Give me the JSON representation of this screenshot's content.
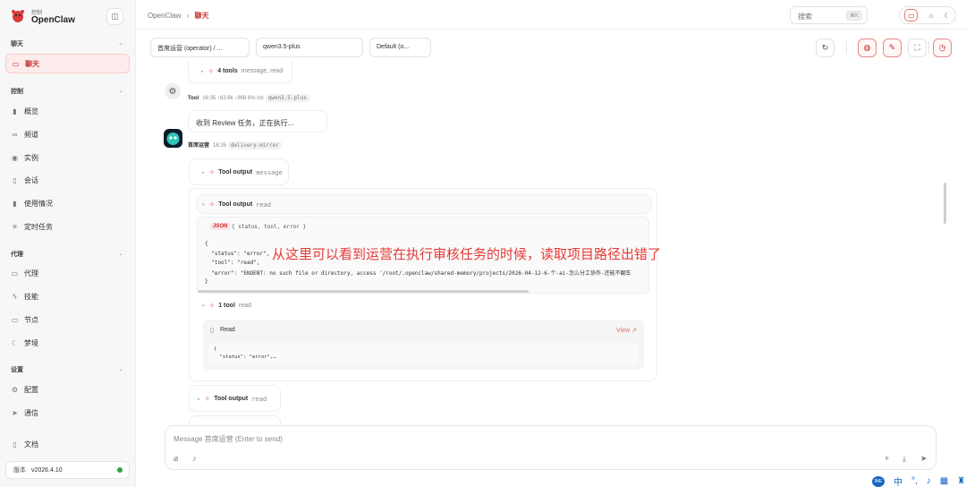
{
  "app": {
    "brand_sub": "控制",
    "brand": "OpenClaw"
  },
  "sidebar": {
    "sections": [
      {
        "title": "聊天"
      },
      {
        "title": "控制"
      },
      {
        "title": "代理"
      },
      {
        "title": "设置"
      }
    ],
    "items": [
      {
        "label": "聊天",
        "icon": "chat-icon"
      },
      {
        "label": "概览",
        "icon": "bar-chart-icon"
      },
      {
        "label": "频道",
        "icon": "link-icon"
      },
      {
        "label": "实例",
        "icon": "radio-icon"
      },
      {
        "label": "会话",
        "icon": "file-icon"
      },
      {
        "label": "使用情况",
        "icon": "bar-chart-icon"
      },
      {
        "label": "定时任务",
        "icon": "spinner-icon"
      },
      {
        "label": "代理",
        "icon": "folder-icon"
      },
      {
        "label": "技能",
        "icon": "bolt-icon"
      },
      {
        "label": "节点",
        "icon": "monitor-icon"
      },
      {
        "label": "梦境",
        "icon": "moon-icon"
      },
      {
        "label": "配置",
        "icon": "gear-icon"
      },
      {
        "label": "通信",
        "icon": "send-icon"
      },
      {
        "label": "文档",
        "icon": "book-icon"
      }
    ],
    "version_label": "版本",
    "version": "v2026.4.10"
  },
  "header": {
    "crumb_root": "OpenClaw",
    "crumb_sep": "›",
    "crumb_current": "聊天",
    "search_placeholder": "搜索",
    "search_kbd": "⌘K"
  },
  "toolbar": {
    "session": "首席运营 (operator) / ...",
    "model": "qwen3.5-plus",
    "thinking": "Default (o..."
  },
  "messages": {
    "tools4_title": "4 tools",
    "tools4_sub": "message, read",
    "tool_meta_name": "Tool",
    "tool_meta_time": "16:35",
    "tool_meta_stats": "↑63.6k ↓969 6% ctx",
    "tool_meta_model": "qwen3.5-plus",
    "bubble": "收到 Review 任务，正在执行...",
    "agent_meta_name": "首席运营",
    "agent_meta_time": "16:35",
    "agent_meta_tag": "delivery-mirror",
    "out1_title": "Tool output",
    "out1_sub": "message",
    "out2_title": "Tool output",
    "out2_sub": "read",
    "json_tag": "JSON",
    "json_hdr": "{ status, tool, error }",
    "code": [
      "{",
      "  \"status\": \"error\",",
      "  \"tool\": \"read\",",
      "  \"error\": \"ENOENT: no such file or directory, access '/root/.openclaw/shared-memory/projects/2026-04-12-6-个-ai-怎么分工协作-还能不翻车",
      "}"
    ],
    "tool1_title": "1 tool",
    "tool1_sub": "read",
    "read_title": "Read",
    "read_view": "View ↗",
    "read_code": [
      "{",
      "  \"status\": \"error\",…"
    ],
    "out3_title": "Tool output",
    "out3_sub": "read"
  },
  "annotation": "从这里可以看到运营在执行审核任务的时候，读取项目路径出错了",
  "composer": {
    "placeholder": "Message 首席运营 (Enter to send)"
  },
  "tray": {
    "ime": "中",
    "punct": "°,"
  }
}
